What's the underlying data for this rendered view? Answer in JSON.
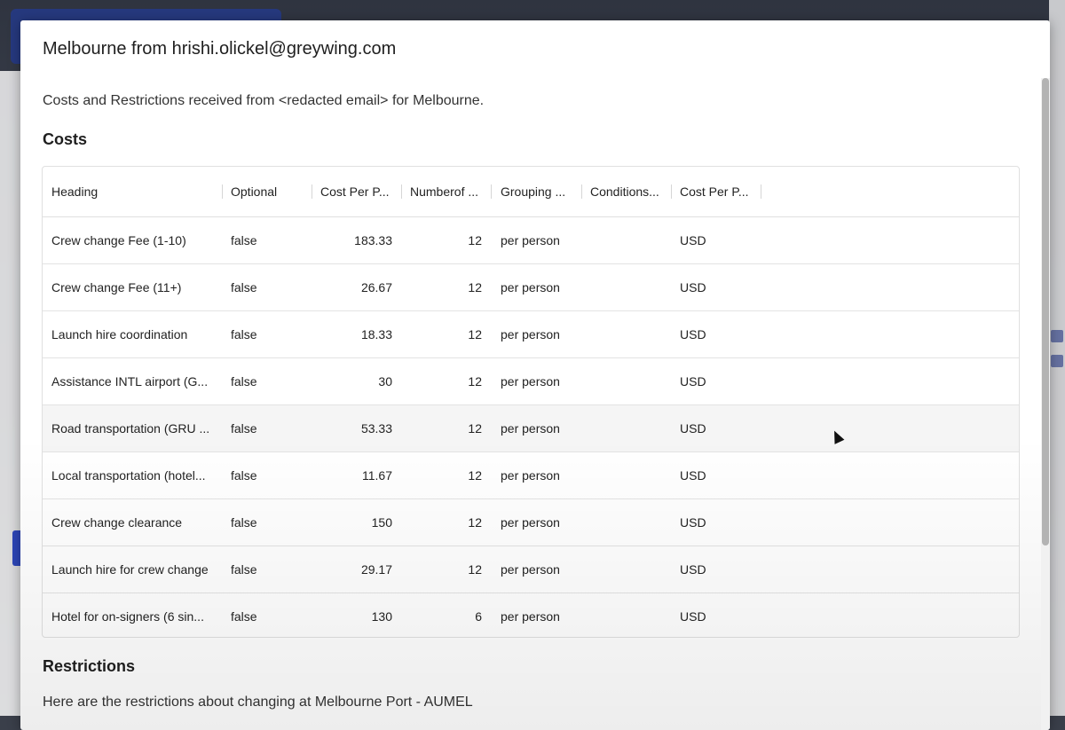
{
  "dialog": {
    "title": "Melbourne from hrishi.olickel@greywing.com",
    "description": "Costs and Restrictions received from <redacted email> for Melbourne."
  },
  "costs": {
    "heading": "Costs",
    "columns": [
      "Heading",
      "Optional",
      "Cost Per P...",
      "Numberof ...",
      "Grouping ...",
      "Conditions...",
      "Cost Per P..."
    ],
    "rows": [
      {
        "heading": "Crew change Fee (1-10)",
        "optional": "false",
        "cost": "183.33",
        "number": "12",
        "grouping": "per person",
        "conditions": "",
        "currency": "USD"
      },
      {
        "heading": "Crew change Fee (11+)",
        "optional": "false",
        "cost": "26.67",
        "number": "12",
        "grouping": "per person",
        "conditions": "",
        "currency": "USD"
      },
      {
        "heading": "Launch hire coordination",
        "optional": "false",
        "cost": "18.33",
        "number": "12",
        "grouping": "per person",
        "conditions": "",
        "currency": "USD"
      },
      {
        "heading": "Assistance INTL airport (G...",
        "optional": "false",
        "cost": "30",
        "number": "12",
        "grouping": "per person",
        "conditions": "",
        "currency": "USD"
      },
      {
        "heading": "Road transportation (GRU ...",
        "optional": "false",
        "cost": "53.33",
        "number": "12",
        "grouping": "per person",
        "conditions": "",
        "currency": "USD"
      },
      {
        "heading": "Local transportation (hotel...",
        "optional": "false",
        "cost": "11.67",
        "number": "12",
        "grouping": "per person",
        "conditions": "",
        "currency": "USD"
      },
      {
        "heading": "Crew change clearance",
        "optional": "false",
        "cost": "150",
        "number": "12",
        "grouping": "per person",
        "conditions": "",
        "currency": "USD"
      },
      {
        "heading": "Launch hire for crew change",
        "optional": "false",
        "cost": "29.17",
        "number": "12",
        "grouping": "per person",
        "conditions": "",
        "currency": "USD"
      },
      {
        "heading": "Hotel for on-signers (6 sin...",
        "optional": "false",
        "cost": "130",
        "number": "6",
        "grouping": "per person",
        "conditions": "",
        "currency": "USD"
      }
    ]
  },
  "restrictions": {
    "heading": "Restrictions",
    "text": "Here are the restrictions about changing at Melbourne Port - AUMEL"
  }
}
